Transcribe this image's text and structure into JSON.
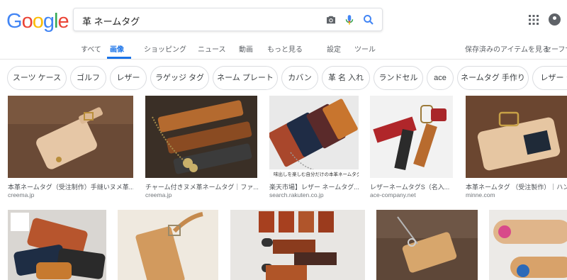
{
  "logo": "Google",
  "search": {
    "query": "革 ネームタグ"
  },
  "tabs": [
    "すべて",
    "画像",
    "ショッピング",
    "ニュース",
    "動画",
    "もっと見る",
    "設定",
    "ツール"
  ],
  "header_right": {
    "saved": "保存済みのアイテムを見る",
    "safesearch": "セーフサ"
  },
  "chips": [
    "スーツ ケース",
    "ゴルフ",
    "レザー",
    "ラゲッジ タグ",
    "ネーム プレート",
    "カバン",
    "革 名 入れ",
    "ランドセル",
    "ace",
    "ネームタグ 手作り",
    "レザー ク"
  ],
  "results": [
    {
      "caption": "本革ネームタグ（受注制作）手縫いヌメ革...",
      "source": "creema.jp"
    },
    {
      "caption": "チャーム付きヌメ革ネームタグ｜ファ...",
      "source": "creema.jp"
    },
    {
      "caption": "楽天市場】レザー ネームタグ...",
      "source": "search.rakuten.co.jp",
      "overlay": "味出しを楽しむ自分だけの本革ネームタグ"
    },
    {
      "caption": "レザーネームタグS（名入...",
      "source": "ace-company.net"
    },
    {
      "caption": "本革ネームタグ （受注製作）｜ハンド",
      "source": "minne.com"
    }
  ],
  "colors": {
    "accent": "#1a73e8",
    "g_blue": "#4285F4",
    "g_red": "#EA4335",
    "g_yellow": "#FBBC05",
    "g_green": "#34A853"
  },
  "icons": [
    "camera-icon",
    "mic-icon",
    "search-icon",
    "apps-icon",
    "avatar-icon"
  ]
}
